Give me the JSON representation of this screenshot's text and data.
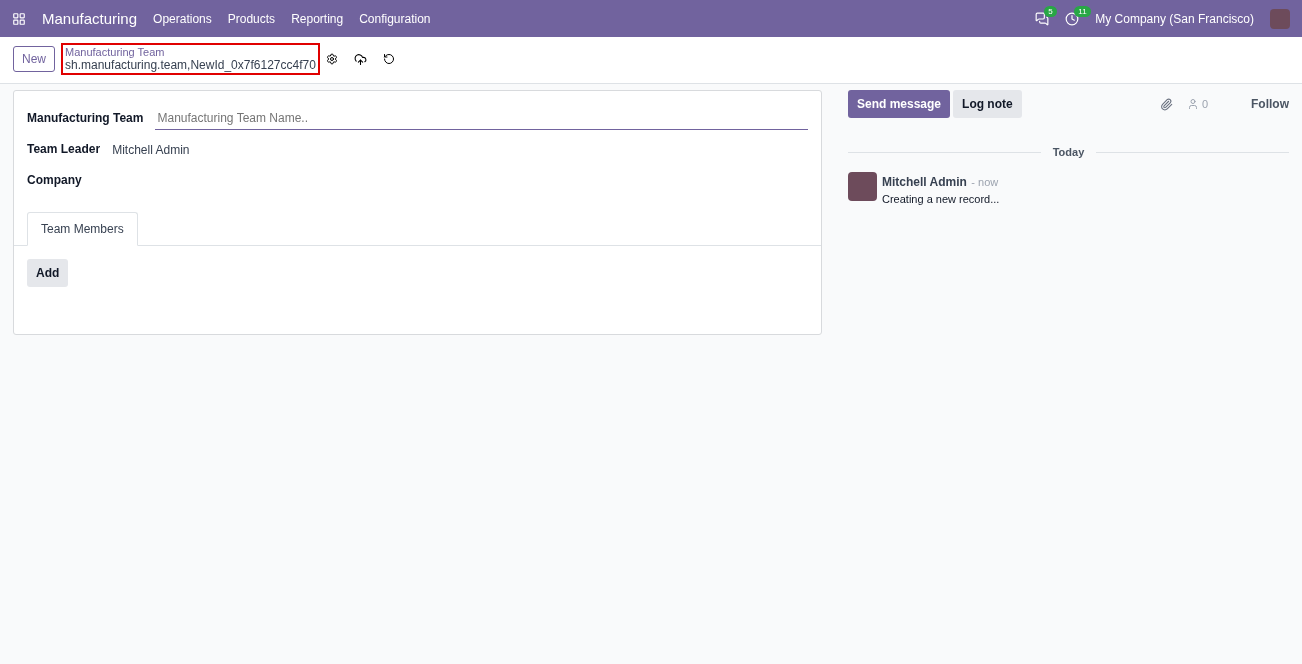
{
  "navbar": {
    "app_name": "Manufacturing",
    "menu": [
      "Operations",
      "Products",
      "Reporting",
      "Configuration"
    ],
    "messages_count": "5",
    "activities_count": "11",
    "company": "My Company (San Francisco)"
  },
  "control_panel": {
    "new_button": "New",
    "breadcrumb_title": "Manufacturing Team",
    "record_id": "sh.manufacturing.team,NewId_0x7f6127cc4f70",
    "highlighted": true
  },
  "form": {
    "fields": [
      {
        "label": "Manufacturing Team",
        "kind": "input",
        "placeholder": "Manufacturing Team Name.."
      },
      {
        "label": "Team Leader",
        "kind": "text",
        "value": "Mitchell Admin"
      },
      {
        "label": "Company",
        "kind": "text"
      }
    ],
    "tabs": [
      {
        "label": "Team Members",
        "selected": true
      }
    ],
    "add_button": "Add"
  },
  "chatter": {
    "send_message": "Send message",
    "log_note": "Log note",
    "followers_count": "0",
    "follow": "Follow",
    "date_separator": "Today",
    "messages": [
      {
        "author": "Mitchell Admin",
        "time": "- now",
        "body": "Creating a new record..."
      }
    ]
  }
}
